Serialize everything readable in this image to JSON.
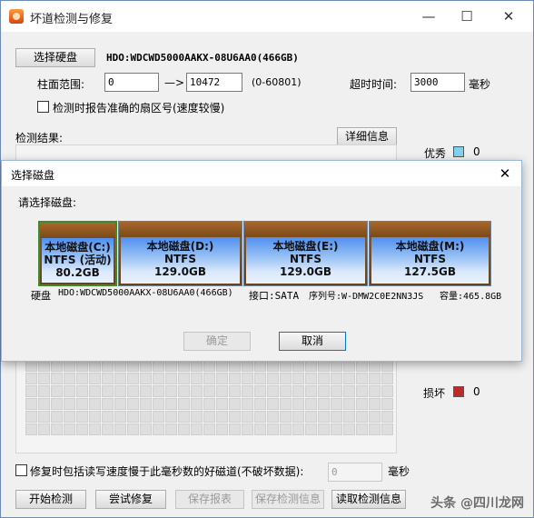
{
  "window": {
    "title": "坏道检测与修复",
    "minimize": "—",
    "maximize": "☐",
    "close": "✕"
  },
  "top": {
    "select_disk_button": "选择硬盘",
    "disk_name": "HDO:WDCWD5000AAKX-08U6AA0(466GB)",
    "cylinder_label": "柱面范围:",
    "cylinder_from": "0",
    "arrow": "—>",
    "cylinder_to": "10472",
    "cylinder_range": "(0-60801)",
    "timeout_label": "超时时间:",
    "timeout_value": "3000",
    "timeout_unit": "毫秒",
    "report_sector_label": "检测时报告准确的扇区号(速度较慢)"
  },
  "results": {
    "label": "检测结果:",
    "details_button": "详细信息",
    "legend_good": "优秀",
    "legend_good_count": "0",
    "legend_bad": "损坏",
    "legend_bad_count": "0",
    "colors": {
      "good": "#7fd3f0",
      "bad": "#c0282a"
    }
  },
  "bottom": {
    "repair_option_label": "修复时包括读写速度慢于此毫秒数的好磁道(不破坏数据):",
    "repair_ms_value": "0",
    "repair_ms_unit": "毫秒",
    "buttons": [
      "开始检测",
      "尝试修复",
      "保存报表",
      "保存检测信息",
      "读取检测信息"
    ]
  },
  "dialog": {
    "title": "选择磁盘",
    "close": "✕",
    "prompt": "请选择磁盘:",
    "disks": [
      {
        "name": "本地磁盘(C:)",
        "fs": "NTFS (活动)",
        "size": "80.2GB"
      },
      {
        "name": "本地磁盘(D:)",
        "fs": "NTFS",
        "size": "129.0GB"
      },
      {
        "name": "本地磁盘(E:)",
        "fs": "NTFS",
        "size": "129.0GB"
      },
      {
        "name": "本地磁盘(M:)",
        "fs": "NTFS",
        "size": "127.5GB"
      }
    ],
    "disk_label": "硬盘",
    "disk_model": "HDO:WDCWD5000AAKX-08U6AA0(466GB)",
    "interface": "接口:SATA",
    "serial": "序列号:W-DMW2C0E2NN3JS",
    "capacity": "容量:465.8GB",
    "ok_button": "确定",
    "cancel_button": "取消"
  },
  "watermark": "头条 @四川龙网"
}
